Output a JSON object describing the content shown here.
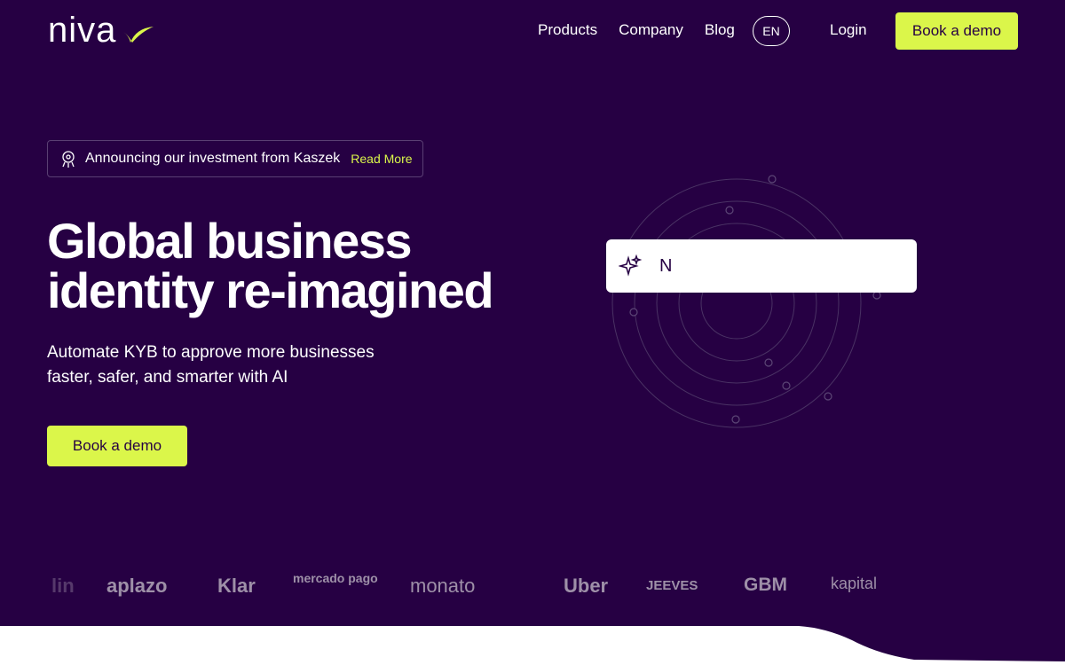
{
  "brand": {
    "name": "niva",
    "accent": "#dbf64a",
    "background": "#260043"
  },
  "nav": {
    "links": [
      "Products",
      "Company",
      "Blog"
    ],
    "language": "EN",
    "login": "Login",
    "cta": "Book a demo"
  },
  "announcement": {
    "icon": "rocket-icon",
    "text": "Announcing our investment from Kaszek",
    "link": "Read More"
  },
  "hero": {
    "title_line1": "Global business",
    "title_line2": "identity re-imagined",
    "subtitle_line1": "Automate KYB to approve more businesses",
    "subtitle_line2": "faster, safer, and smarter with AI",
    "cta": "Book a demo"
  },
  "search_card": {
    "icon": "sparkle-icon",
    "text": "N"
  },
  "customer_logos": [
    "lin",
    "aplazo",
    "Klar",
    "mercado pago",
    "monato",
    "Uber",
    "JEEVES",
    "GBM",
    "kapital"
  ]
}
